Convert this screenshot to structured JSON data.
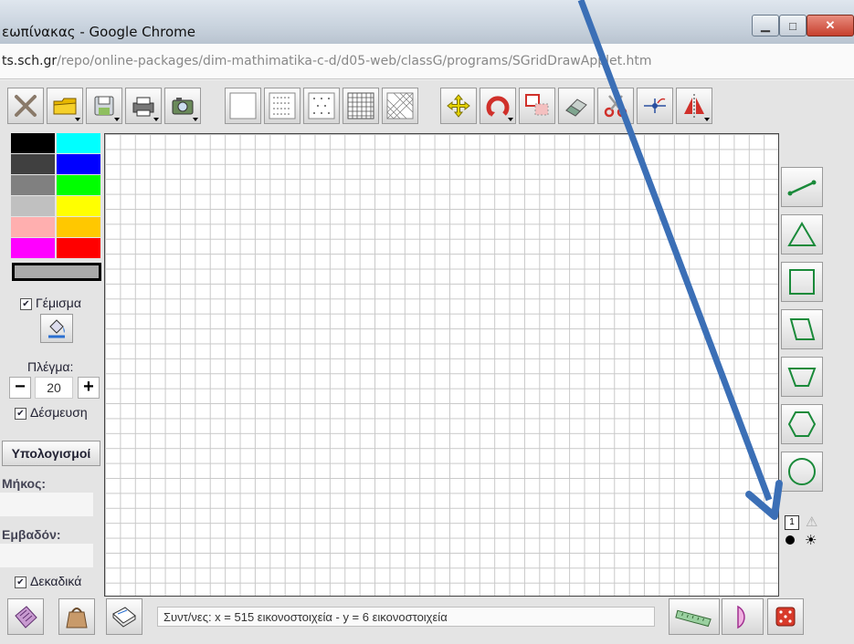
{
  "window": {
    "title": "εωπίνακας - Google Chrome",
    "url_domain": "ts.sch.gr",
    "url_path": "/repo/online-packages/dim-mathimatika-c-d/d05-web/classG/programs/SGridDrawApplet.htm",
    "controls": [
      "minimize-icon",
      "maximize-icon",
      "close-icon"
    ]
  },
  "toolbar": {
    "tools": [
      "delete-icon",
      "open-folder-icon",
      "save-icon",
      "print-icon",
      "camera-icon",
      "blank-grid-icon",
      "fine-dot-grid-icon",
      "dot-grid-icon",
      "square-grid-icon",
      "isometric-grid-icon",
      "move-icon",
      "rotate-icon",
      "reflect-selection-icon",
      "eraser-icon",
      "scissors-icon",
      "point-tool-icon",
      "symmetry-icon"
    ]
  },
  "palette": {
    "colors": [
      "#000000",
      "#00ffff",
      "#404040",
      "#0000ff",
      "#808080",
      "#00ff00",
      "#c0c0c0",
      "#ffff00",
      "#ffafaf",
      "#ffc800",
      "#ff00ff",
      "#ff0000"
    ]
  },
  "left": {
    "fill_label": "Γέμισμα",
    "fill_checked": true,
    "grid_label": "Πλέγμα:",
    "grid_minus": "−",
    "grid_value": "20",
    "grid_plus": "+",
    "snap_label": "Δέσμευση",
    "snap_checked": true,
    "calc_label": "Υπολογισμοί",
    "length_label": "Μήκος:",
    "area_label": "Εμβαδόν:",
    "decimals_label": "Δεκαδικά",
    "decimals_checked": true
  },
  "shapes": [
    "line-segment-icon",
    "triangle-icon",
    "square-icon",
    "parallelogram-icon",
    "trapezoid-icon",
    "hexagon-icon",
    "circle-icon"
  ],
  "small_options": {
    "number_label": "1",
    "icons": [
      "warning-icon",
      "dot-icon",
      "sun-icon"
    ]
  },
  "bottom": {
    "status": "Συντ/νες: x = 515 εικονοστοιχεία - y = 6 εικονοστοιχεία",
    "tools": [
      "calculator-icon",
      "bag-icon",
      "notebook-icon",
      "ruler-icon",
      "protractor-icon",
      "dice-icon"
    ]
  },
  "colors": {
    "arrow": "#3b6fb6",
    "shape_stroke": "#1a8a3a"
  }
}
